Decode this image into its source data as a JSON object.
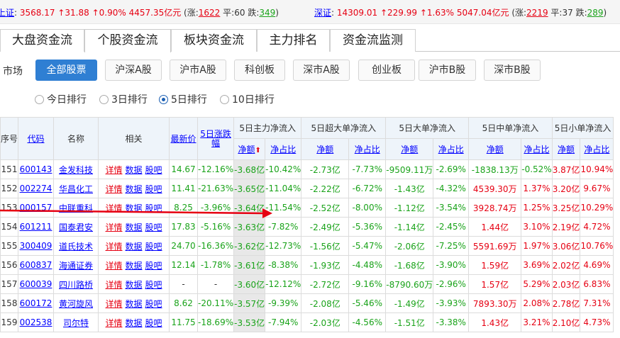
{
  "index_bar": {
    "sh": {
      "name": "上证",
      "value": "3568.17",
      "change": "↑31.88",
      "pct": "↑0.90%",
      "amount": "4457.35亿元",
      "up_label": "(涨:",
      "up": "1622",
      "flat_label": "平:",
      "flat": "60",
      "down_label": "跌:",
      "down": "349",
      "close": ")"
    },
    "sz": {
      "name": "深证",
      "value": "14309.01",
      "change": "↑229.99",
      "pct": "↑1.63%",
      "amount": "5047.04亿元",
      "up_label": "(涨:",
      "up": "2219",
      "flat_label": "平:",
      "flat": "37",
      "down_label": "跌:",
      "down": "289",
      "close": ")"
    }
  },
  "main_tabs": [
    "大盘资金流",
    "个股资金流",
    "板块资金流",
    "主力排名",
    "资金流监测"
  ],
  "market": {
    "label": "市场",
    "buttons": [
      "全部股票",
      "沪深A股",
      "沪市A股",
      "科创板",
      "深市A股",
      "创业板",
      "沪市B股",
      "深市B股"
    ]
  },
  "rank_options": [
    "今日排行",
    "3日排行",
    "5日排行",
    "10日排行"
  ],
  "table": {
    "headers": {
      "seq": "序号",
      "code": "代码",
      "name": "名称",
      "related": "相关",
      "price": "最新价",
      "change": "5日涨跌幅",
      "main": "5日主力净流入",
      "super": "5日超大单净流入",
      "big": "5日大单净流入",
      "mid": "5日中单净流入",
      "small": "5日小单净流入",
      "amount": "净额",
      "ratio": "净占比"
    },
    "op_labels": [
      "详情",
      "数据",
      "股吧"
    ],
    "rows": [
      {
        "seq": "151",
        "code": "600143",
        "name": "金发科技",
        "price": "14.67",
        "chg": "-12.16%",
        "main_amt": "-3.68亿",
        "main_pct": "-10.42%",
        "super_amt": "-2.73亿",
        "super_pct": "-7.73%",
        "big_amt": "-9509.11万",
        "big_pct": "-2.69%",
        "mid_amt": "-1838.13万",
        "mid_pct": "-0.52%",
        "small_amt": "3.87亿",
        "small_pct": "10.94%"
      },
      {
        "seq": "152",
        "code": "002274",
        "name": "华昌化工",
        "price": "11.41",
        "chg": "-21.63%",
        "main_amt": "-3.65亿",
        "main_pct": "-11.04%",
        "super_amt": "-2.22亿",
        "super_pct": "-6.72%",
        "big_amt": "-1.43亿",
        "big_pct": "-4.32%",
        "mid_amt": "4539.30万",
        "mid_pct": "1.37%",
        "small_amt": "3.20亿",
        "small_pct": "9.67%"
      },
      {
        "seq": "153",
        "code": "000157",
        "name": "中联重科",
        "price": "8.25",
        "chg": "-3.96%",
        "main_amt": "-3.64亿",
        "main_pct": "-11.54%",
        "super_amt": "-2.52亿",
        "super_pct": "-8.00%",
        "big_amt": "-1.12亿",
        "big_pct": "-3.54%",
        "mid_amt": "3928.74万",
        "mid_pct": "1.25%",
        "small_amt": "3.25亿",
        "small_pct": "10.29%"
      },
      {
        "seq": "154",
        "code": "601211",
        "name": "国泰君安",
        "price": "17.83",
        "chg": "-5.16%",
        "main_amt": "-3.63亿",
        "main_pct": "-7.82%",
        "super_amt": "-2.49亿",
        "super_pct": "-5.36%",
        "big_amt": "-1.14亿",
        "big_pct": "-2.45%",
        "mid_amt": "1.44亿",
        "mid_pct": "3.10%",
        "small_amt": "2.19亿",
        "small_pct": "4.72%"
      },
      {
        "seq": "155",
        "code": "300409",
        "name": "道氏技术",
        "price": "24.70",
        "chg": "-16.36%",
        "main_amt": "-3.62亿",
        "main_pct": "-12.73%",
        "super_amt": "-1.56亿",
        "super_pct": "-5.47%",
        "big_amt": "-2.06亿",
        "big_pct": "-7.25%",
        "mid_amt": "5591.69万",
        "mid_pct": "1.97%",
        "small_amt": "3.06亿",
        "small_pct": "10.76%"
      },
      {
        "seq": "156",
        "code": "600837",
        "name": "海通证券",
        "price": "12.14",
        "chg": "-1.78%",
        "main_amt": "-3.61亿",
        "main_pct": "-8.38%",
        "super_amt": "-1.93亿",
        "super_pct": "-4.48%",
        "big_amt": "-1.68亿",
        "big_pct": "-3.90%",
        "mid_amt": "1.59亿",
        "mid_pct": "3.69%",
        "small_amt": "2.02亿",
        "small_pct": "4.69%"
      },
      {
        "seq": "157",
        "code": "600039",
        "name": "四川路桥",
        "price": "-",
        "chg": "-",
        "main_amt": "-3.60亿",
        "main_pct": "-12.12%",
        "super_amt": "-2.72亿",
        "super_pct": "-9.16%",
        "big_amt": "-8790.60万",
        "big_pct": "-2.96%",
        "mid_amt": "1.57亿",
        "mid_pct": "5.29%",
        "small_amt": "2.03亿",
        "small_pct": "6.83%"
      },
      {
        "seq": "158",
        "code": "600172",
        "name": "黄河旋风",
        "price": "8.62",
        "chg": "-20.11%",
        "main_amt": "-3.57亿",
        "main_pct": "-9.39%",
        "super_amt": "-2.08亿",
        "super_pct": "-5.46%",
        "big_amt": "-1.49亿",
        "big_pct": "-3.93%",
        "mid_amt": "7893.30万",
        "mid_pct": "2.08%",
        "small_amt": "2.78亿",
        "small_pct": "7.31%"
      },
      {
        "seq": "159",
        "code": "002538",
        "name": "司尔特",
        "price": "11.75",
        "chg": "-18.69%",
        "main_amt": "-3.53亿",
        "main_pct": "-7.94%",
        "super_amt": "-2.03亿",
        "super_pct": "-4.56%",
        "big_amt": "-1.51亿",
        "big_pct": "-3.38%",
        "mid_amt": "1.43亿",
        "mid_pct": "3.21%",
        "small_amt": "2.10亿",
        "small_pct": "4.73%"
      }
    ]
  },
  "colors": {
    "up": "#e60012",
    "down": "#1aa31a",
    "link": "#0000ff",
    "accent": "#2f7fd3",
    "annotation_arrow": "#e60012"
  }
}
